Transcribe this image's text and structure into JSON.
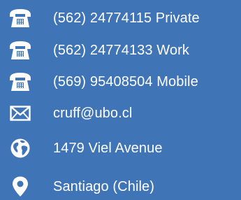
{
  "contacts": [
    {
      "icon": "telephone-icon",
      "text": "(562) 24774115 Private"
    },
    {
      "icon": "telephone-icon",
      "text": "(562) 24774133 Work"
    },
    {
      "icon": "telephone-icon",
      "text": "(569) 95408504 Mobile"
    },
    {
      "icon": "envelope-icon",
      "text": "cruff@ubo.cl"
    },
    {
      "icon": "globe-icon",
      "text": "1479 Viel Avenue"
    },
    {
      "icon": "map-pin-icon",
      "text": "Santiago (Chile)"
    }
  ],
  "colors": {
    "background": "#3f74b7",
    "foreground": "#ffffff"
  }
}
